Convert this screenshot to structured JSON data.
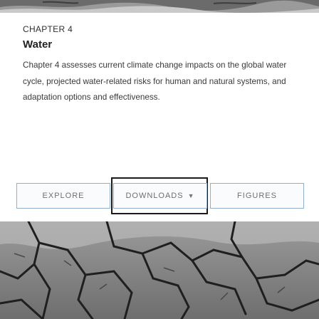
{
  "header": {
    "chapter": "CHAPTER 4",
    "title": "Water",
    "summary": "Chapter 4 assesses current climate change impacts on the global water cycle, projected water-related risks for human and natural systems, and adaptation options and effectiveness."
  },
  "tabs": [
    {
      "label": "EXPLORE",
      "has_dropdown": false
    },
    {
      "label": "DOWNLOADS",
      "has_dropdown": true,
      "icon": "chevron-down-icon",
      "focused": true
    },
    {
      "label": "FIGURES",
      "has_dropdown": false
    }
  ]
}
